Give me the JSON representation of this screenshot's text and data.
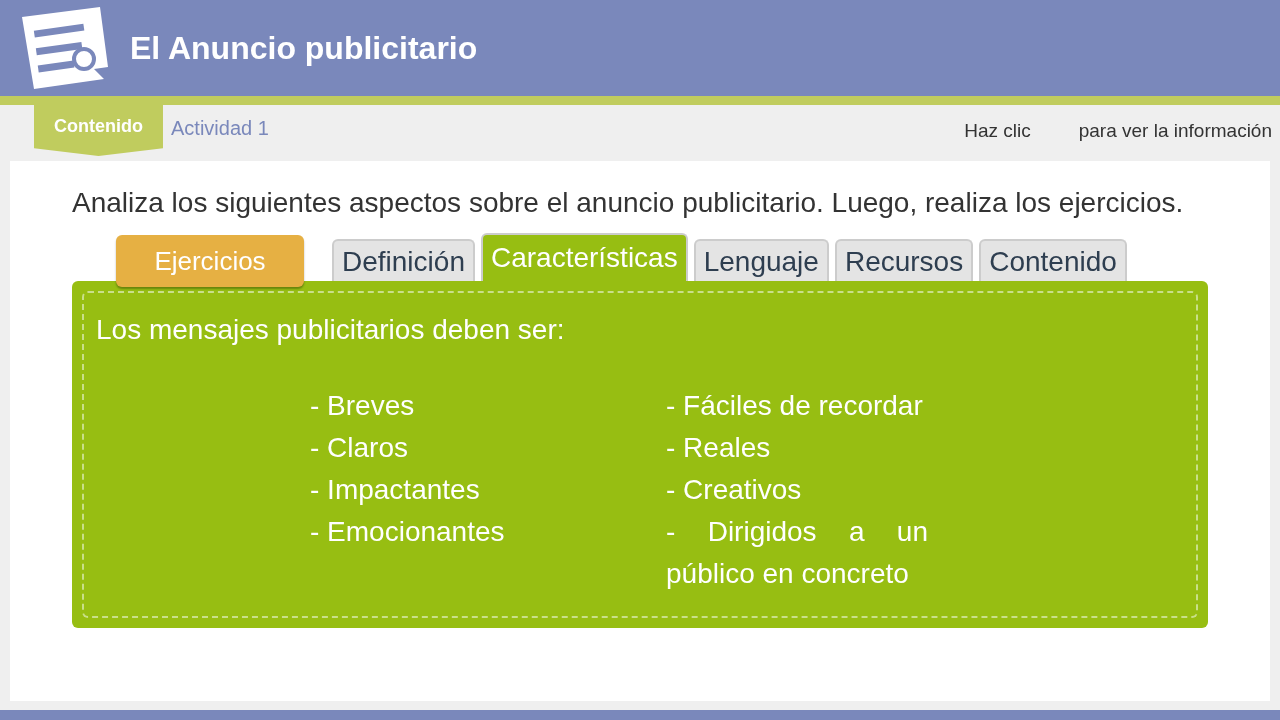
{
  "header": {
    "title": "El Anuncio publicitario"
  },
  "nav": [
    {
      "label": "Contenido",
      "selected": true
    },
    {
      "label": "Actividad 1",
      "selected": false
    }
  ],
  "hint": [
    "Haz clic",
    "para ver la información"
  ],
  "intro": "Analiza los siguientes aspectos sobre el anuncio publicitario. Luego, realiza los ejercicios.",
  "exercises_button": "Ejercicios",
  "tabs": [
    {
      "label": "Definición",
      "selected": false
    },
    {
      "label": "Características",
      "selected": true
    },
    {
      "label": "Lenguaje",
      "selected": false
    },
    {
      "label": "Recursos",
      "selected": false
    },
    {
      "label": "Contenido",
      "selected": false
    }
  ],
  "panel": {
    "heading": "Los mensajes publicitarios deben ser:",
    "column_1": [
      "- Breves",
      "- Claros",
      "- Impactantes",
      "- Emocionantes"
    ],
    "column_2": [
      "- Fáciles de recordar",
      "- Reales",
      "- Creativos",
      "- Dirigidos a un público en concreto"
    ]
  }
}
